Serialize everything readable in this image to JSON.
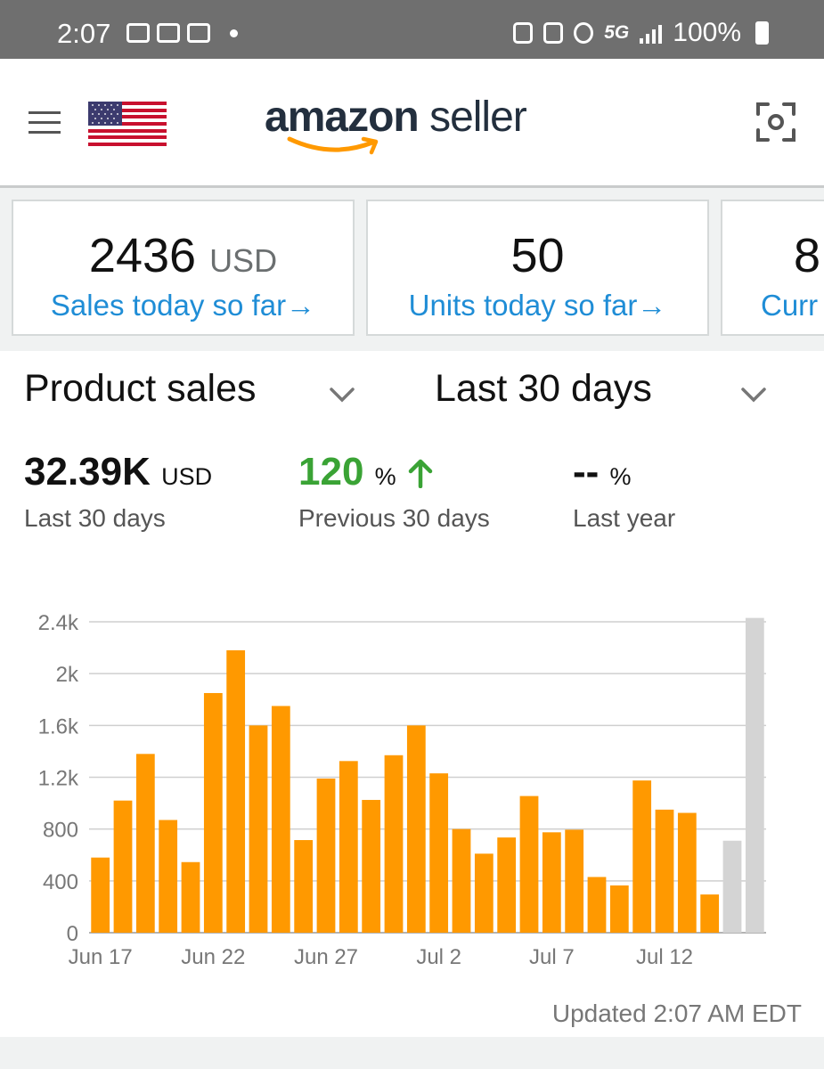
{
  "status_bar": {
    "time": "2:07",
    "network": "5G",
    "battery": "100%"
  },
  "app_bar": {
    "logo_main": "amazon",
    "logo_sub": "seller"
  },
  "kpis": [
    {
      "value": "2436",
      "unit": "USD",
      "label": "Sales today so far→"
    },
    {
      "value": "50",
      "unit": "",
      "label": "Units today so far→"
    },
    {
      "value": "8",
      "unit": "",
      "label": "Curr"
    }
  ],
  "selectors": {
    "metric": "Product sales",
    "range": "Last 30 days"
  },
  "metrics": [
    {
      "value": "32.39K",
      "unit": "USD",
      "label": "Last 30 days"
    },
    {
      "value": "120",
      "unit": "%",
      "label": "Previous 30 days",
      "trend": "up"
    },
    {
      "value": "--",
      "unit": "%",
      "label": "Last year"
    }
  ],
  "updated_text": "Updated 2:07 AM EDT",
  "colors": {
    "bar": "#ff9900",
    "projected_bar": "#d4d4d4",
    "link": "#1f8dd6",
    "positive": "#3aa335"
  },
  "chart_data": {
    "type": "bar",
    "categories": [
      "Jun 17",
      "Jun 18",
      "Jun 19",
      "Jun 20",
      "Jun 21",
      "Jun 22",
      "Jun 23",
      "Jun 24",
      "Jun 25",
      "Jun 26",
      "Jun 27",
      "Jun 28",
      "Jun 29",
      "Jun 30",
      "Jul 1",
      "Jul 2",
      "Jul 3",
      "Jul 4",
      "Jul 5",
      "Jul 6",
      "Jul 7",
      "Jul 8",
      "Jul 9",
      "Jul 10",
      "Jul 11",
      "Jul 12",
      "Jul 13",
      "Jul 14",
      "Jul 15",
      "Jul 16"
    ],
    "x_tick_labels": [
      "Jun 17",
      "Jun 22",
      "Jun 27",
      "Jul 2",
      "Jul 7",
      "Jul 12"
    ],
    "x_tick_indices": [
      0,
      5,
      10,
      15,
      20,
      25
    ],
    "series": [
      {
        "values": [
          580,
          1020,
          1380,
          870,
          545,
          1850,
          2180,
          1600,
          1750,
          715,
          1190,
          1325,
          1025,
          1370,
          1600,
          1230,
          800,
          610,
          735,
          1055,
          775,
          795,
          430,
          365,
          1175,
          950,
          925,
          295,
          710,
          2430
        ]
      }
    ],
    "projected_indices": [
      28,
      29
    ],
    "y_ticks": [
      "0",
      "400",
      "800",
      "1.2k",
      "1.6k",
      "2k",
      "2.4k"
    ],
    "y_tick_values": [
      0,
      400,
      800,
      1200,
      1600,
      2000,
      2400
    ],
    "ylim": [
      0,
      2400
    ],
    "grid": true
  }
}
